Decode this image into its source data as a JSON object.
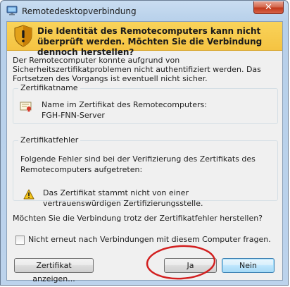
{
  "window": {
    "title": "Remotedesktopverbindung",
    "close_label": "✕"
  },
  "banner": {
    "text": "Die Identität des Remotecomputers kann nicht überprüft werden. Möchten Sie die Verbindung dennoch herstellen?"
  },
  "intro": "Der Remotecomputer konnte aufgrund von Sicherheitszertifikatproblemen nicht authentifiziert werden. Das Fortsetzen des Vorgangs ist eventuell nicht sicher.",
  "cert_group": {
    "legend": "Zertifikatname",
    "label": "Name im Zertifikat des Remotecomputers:",
    "value": "FGH-FNN-Server"
  },
  "error_group": {
    "legend": "Zertifikatfehler",
    "intro": "Folgende Fehler sind bei der Verifizierung des Zertifikats des Remotecomputers aufgetreten:",
    "error": "Das Zertifikat stammt nicht von einer vertrauenswürdigen Zertifizierungsstelle."
  },
  "question": "Möchten Sie die Verbindung trotz der Zertifikatfehler herstellen?",
  "checkbox": {
    "label": "Nicht erneut nach Verbindungen mit diesem Computer fragen.",
    "checked": false
  },
  "buttons": {
    "view_cert": "Zertifikat anzeigen...",
    "yes": "Ja",
    "no": "Nein"
  },
  "colors": {
    "banner": "#f7cb4d",
    "highlight_circle": "#d21f1f"
  }
}
